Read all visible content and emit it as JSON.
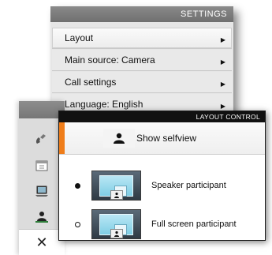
{
  "settings": {
    "title": "SETTINGS",
    "items": [
      {
        "label": "Layout",
        "selected": true
      },
      {
        "label": "Main source: Camera",
        "selected": false
      },
      {
        "label": "Call settings",
        "selected": false
      },
      {
        "label": "Language: English",
        "selected": false
      }
    ]
  },
  "toolbar": {
    "icons": [
      "phone-icon",
      "calendar-icon",
      "laptop-icon",
      "selfview-person-icon",
      "tools-icon"
    ],
    "active": "tools-icon"
  },
  "layout_control": {
    "title": "LAYOUT CONTROL",
    "selfview": {
      "label": "Show selfview"
    },
    "options": [
      {
        "label": "Speaker participant",
        "checked": true
      },
      {
        "label": "Full screen participant",
        "checked": false
      }
    ]
  },
  "colors": {
    "accent": "#ef7d1a",
    "header_dark": "#111111",
    "header_gray": "#7a7a7a"
  }
}
